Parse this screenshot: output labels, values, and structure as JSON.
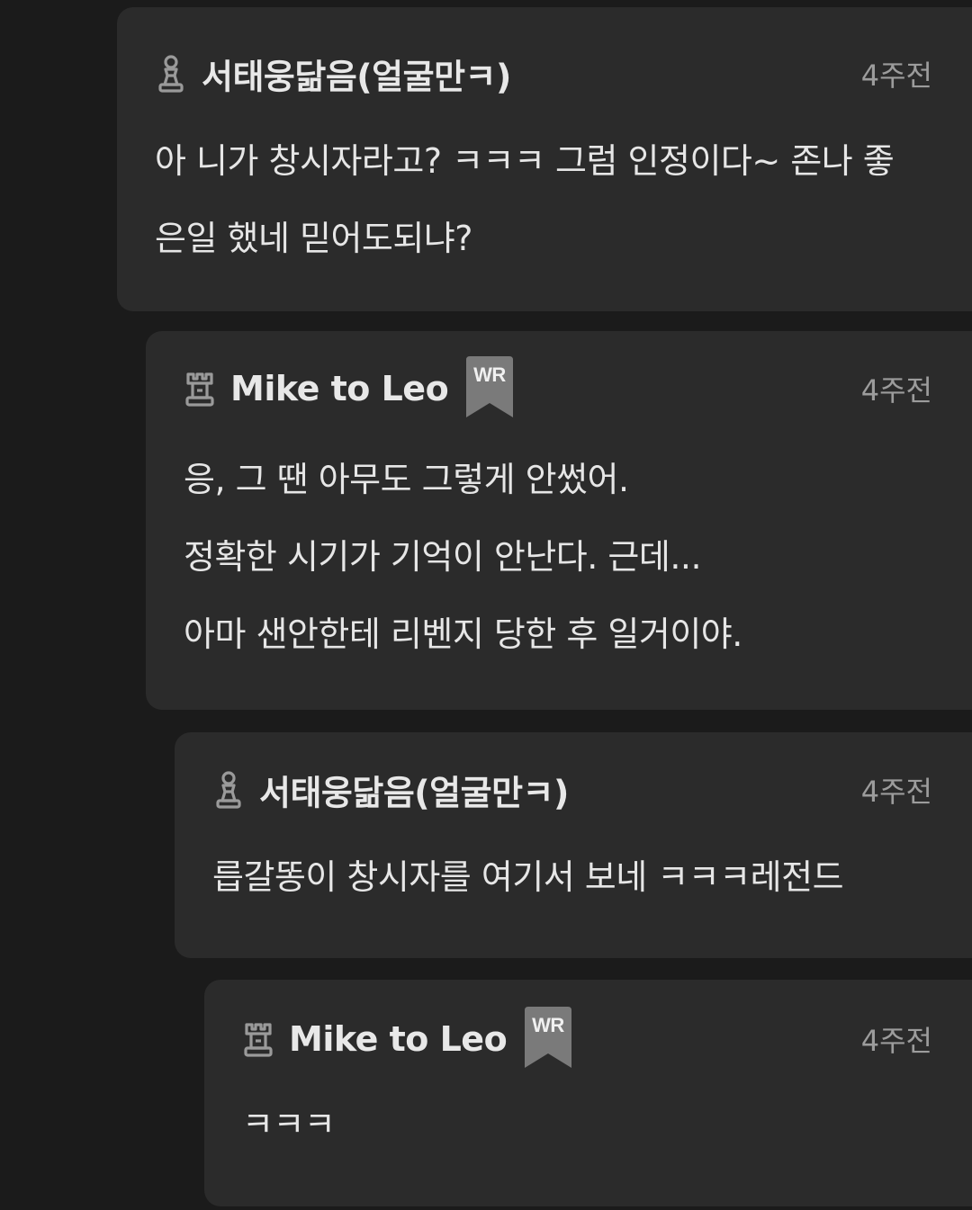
{
  "comments": [
    {
      "author": "서태웅닮음(얼굴만ㅋ)",
      "rank_icon": "pawn-icon",
      "is_writer": false,
      "time": "4주전",
      "lines": [
        "아 니가 창시자라고? ㅋㅋㅋ 그럼 인정이다~ 존나 좋",
        "은일 했네 믿어도되냐?"
      ]
    },
    {
      "author": "Mike to Leo",
      "rank_icon": "rook-icon",
      "is_writer": true,
      "badge": "WR",
      "time": "4주전",
      "lines": [
        "응, 그 땐 아무도 그렇게 안썼어.",
        "정확한 시기가 기억이 안난다. 근데...",
        "아마 샌안한테 리벤지 당한 후 일거이야."
      ]
    },
    {
      "author": "서태웅닮음(얼굴만ㅋ)",
      "rank_icon": "pawn-icon",
      "is_writer": false,
      "time": "4주전",
      "lines": [
        "릅갈똥이 창시자를 여기서 보네 ㅋㅋㅋ레전드"
      ]
    },
    {
      "author": "Mike to Leo",
      "rank_icon": "rook-icon",
      "is_writer": true,
      "badge": "WR",
      "time": "4주전",
      "lines": [
        "ㅋㅋㅋ"
      ]
    }
  ],
  "colors": {
    "background": "#1b1b1b",
    "card": "#2b2b2b",
    "text": "#e6e6e6",
    "muted": "#9c9c9c",
    "badge": "#7a7a7a"
  }
}
